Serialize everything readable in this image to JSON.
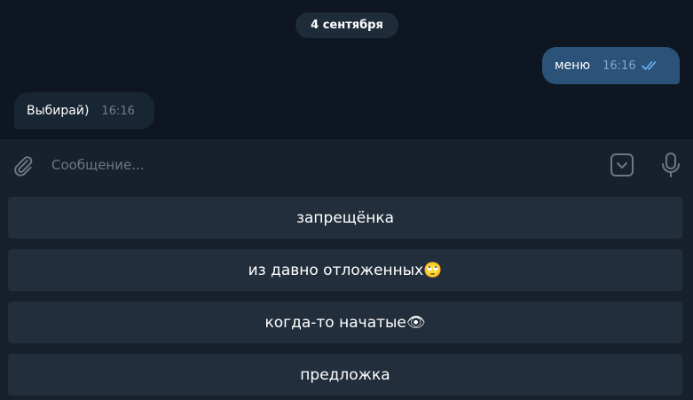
{
  "chat": {
    "date_label": "4 сентября",
    "messages": [
      {
        "direction": "outgoing",
        "text": "меню",
        "time": "16:16",
        "status": "read"
      },
      {
        "direction": "incoming",
        "text": "Выбирай)",
        "time": "16:16"
      }
    ]
  },
  "composer": {
    "placeholder": "Сообщение...",
    "icons": [
      "paperclip-icon",
      "keyboard-toggle-icon",
      "microphone-icon"
    ]
  },
  "reply_keyboard": {
    "buttons": [
      {
        "label": "запрещёнка"
      },
      {
        "label": "из давно отложенных🙄"
      },
      {
        "label": "когда-то начатые👁"
      },
      {
        "label": "предложка"
      }
    ]
  },
  "colors": {
    "chat_background": "#0e1621",
    "outgoing_bubble": "#2b5278",
    "incoming_bubble": "#182533",
    "panel": "#17212b",
    "keyboard_button": "#232e3c",
    "read_check": "#6ab3f3"
  }
}
